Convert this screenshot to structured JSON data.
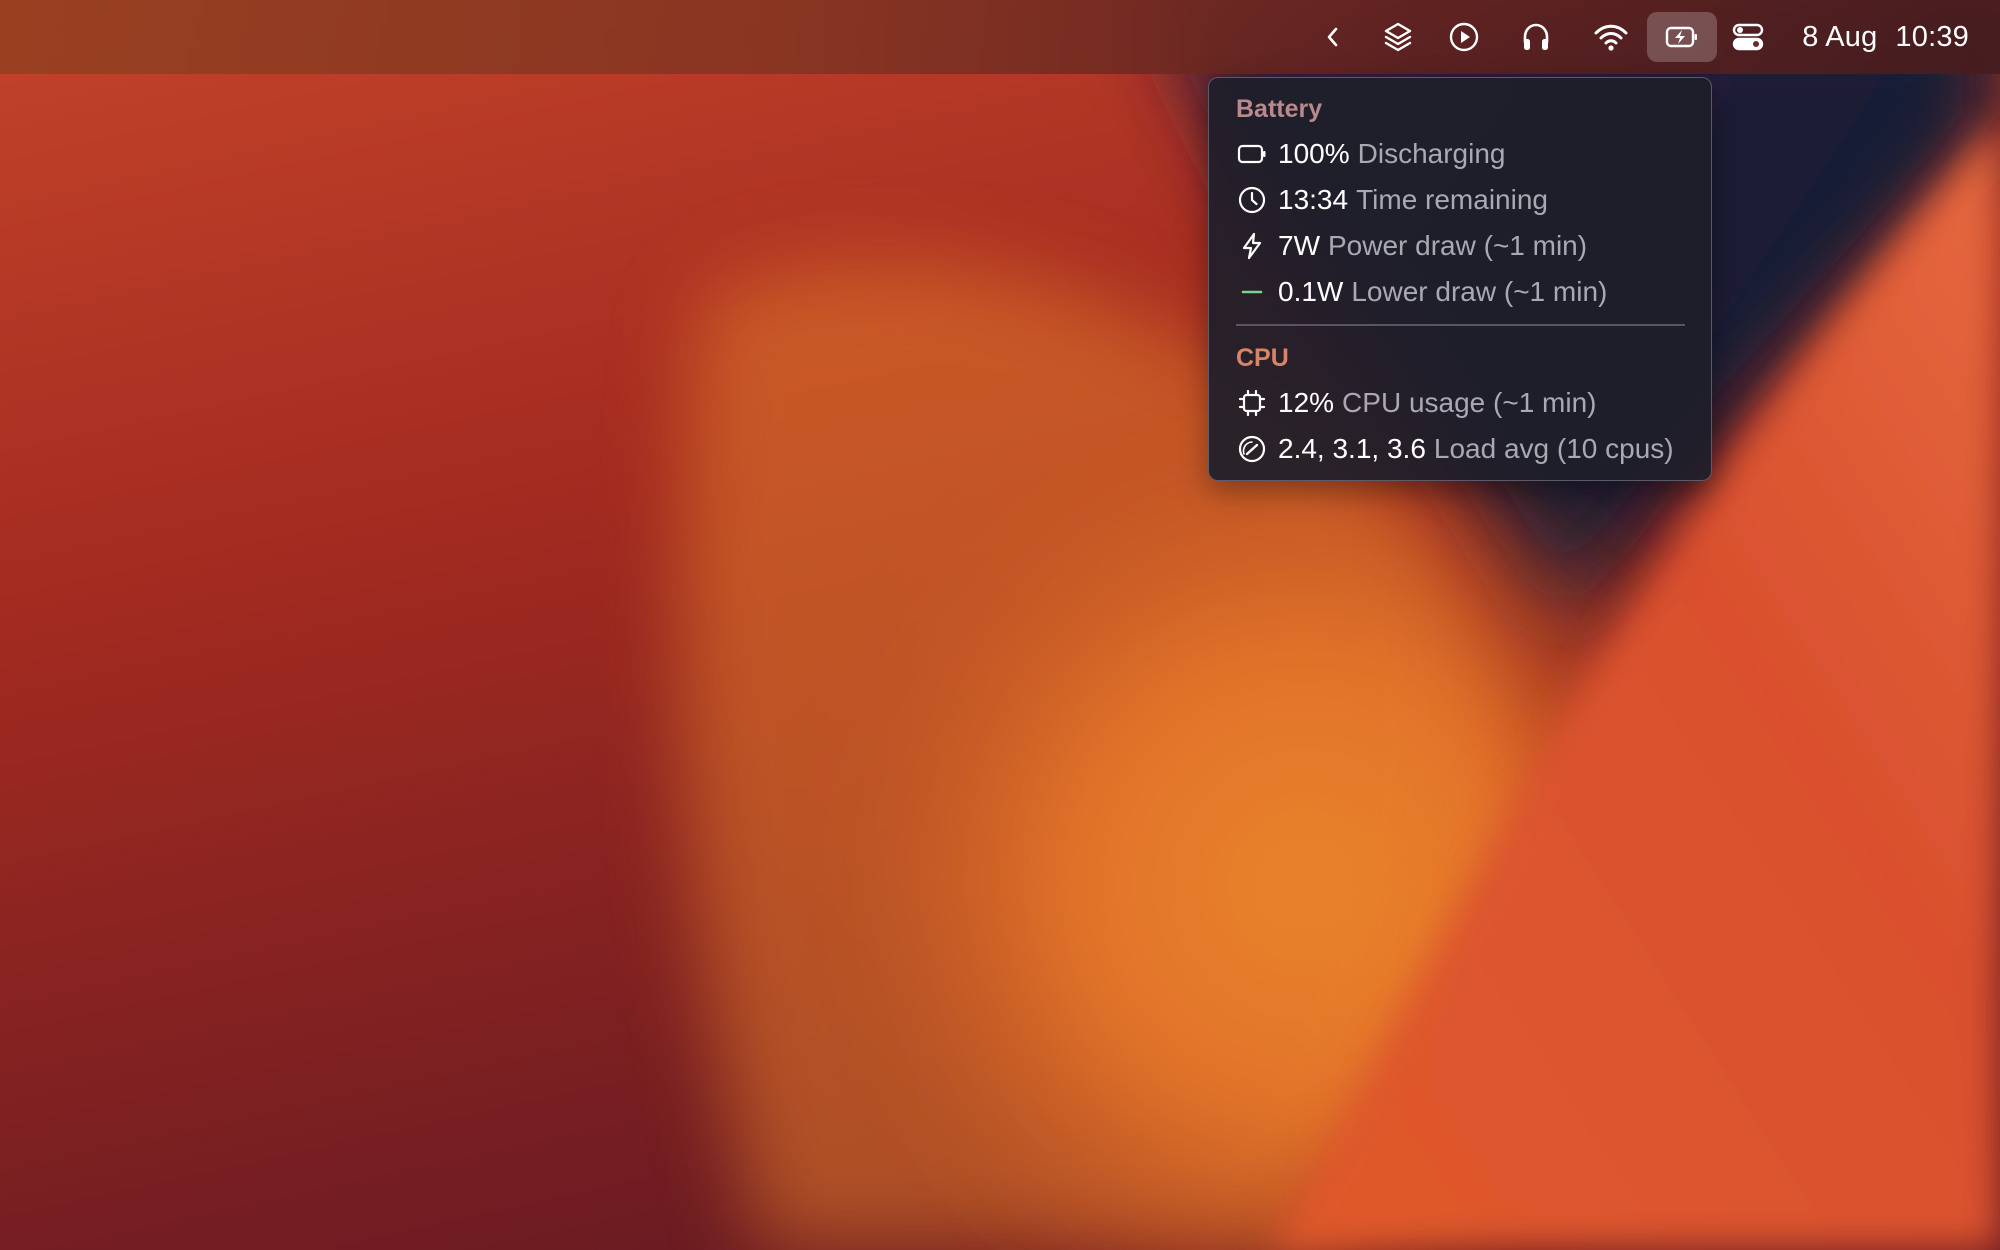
{
  "menubar": {
    "icons": [
      {
        "name": "chevron-left-icon"
      },
      {
        "name": "layers-icon"
      },
      {
        "name": "play-circle-icon"
      },
      {
        "name": "headphones-icon"
      },
      {
        "name": "wifi-icon"
      },
      {
        "name": "battery-charging-icon",
        "active": true
      },
      {
        "name": "control-center-icon"
      }
    ],
    "date": "8 Aug",
    "time": "10:39"
  },
  "popover": {
    "battery": {
      "title": "Battery",
      "rows": [
        {
          "icon": "battery-icon",
          "value": "100%",
          "label": "Discharging"
        },
        {
          "icon": "clock-icon",
          "value": "13:34",
          "label": "Time remaining"
        },
        {
          "icon": "lightning-icon",
          "value": "7W",
          "label": "Power draw (~1 min)"
        },
        {
          "icon": "minus-icon",
          "value": "0.1W",
          "label": "Lower draw (~1 min)"
        }
      ]
    },
    "cpu": {
      "title": "CPU",
      "rows": [
        {
          "icon": "cpu-chip-icon",
          "value": "12%",
          "label": "CPU usage (~1 min)"
        },
        {
          "icon": "gauge-icon",
          "value": "2.4, 3.1, 3.6",
          "label": "Load avg (10 cpus)"
        }
      ]
    }
  },
  "colors": {
    "battery_title": "#b88a8c",
    "cpu_title": "#d98468",
    "minus_icon": "#7ed389",
    "value_text": "#ffffff",
    "label_text": "#a9a9b3"
  }
}
